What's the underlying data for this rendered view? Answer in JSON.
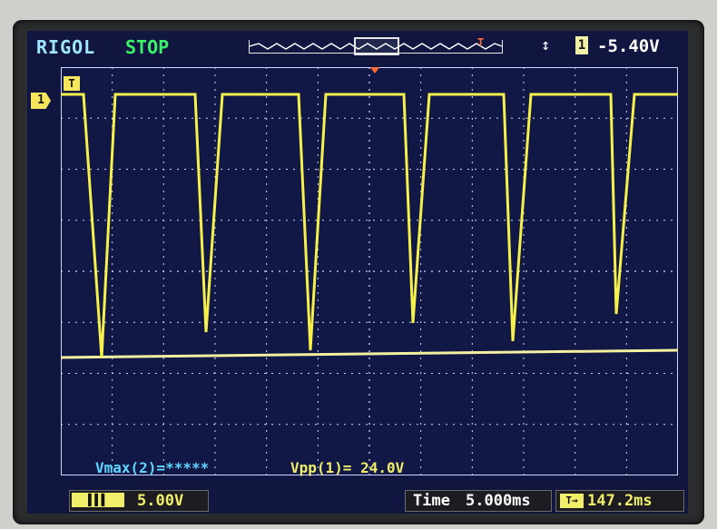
{
  "header": {
    "brand": "RIGOL",
    "run_state": "STOP",
    "trigger_source": "1",
    "trigger_level": "-5.40V",
    "trigger_position_marker": "T"
  },
  "channel": {
    "marker": "1",
    "trigger_marker": "T",
    "scale": "5.00V",
    "trace_color": "#f5f04a"
  },
  "measurements": {
    "vmax": "Vmax(2)=*****",
    "vpp": "Vpp(1)= 24.0V"
  },
  "timebase": {
    "label": "Time",
    "scale": "5.000ms",
    "offset": "147.2ms"
  },
  "colors": {
    "screen_bg": "#10163f",
    "grid": "#cfd6ff",
    "trace": "#f5f04a",
    "brand": "#9fe6ff",
    "stop": "#3cf06a",
    "trigger": "#ff6a3a"
  },
  "waveform": {
    "shape": "repeating negative-going pulses (sawtooth-like recovery)",
    "high_level_div": 4.0,
    "low_level_div": -0.5,
    "period_div": 1.2
  }
}
